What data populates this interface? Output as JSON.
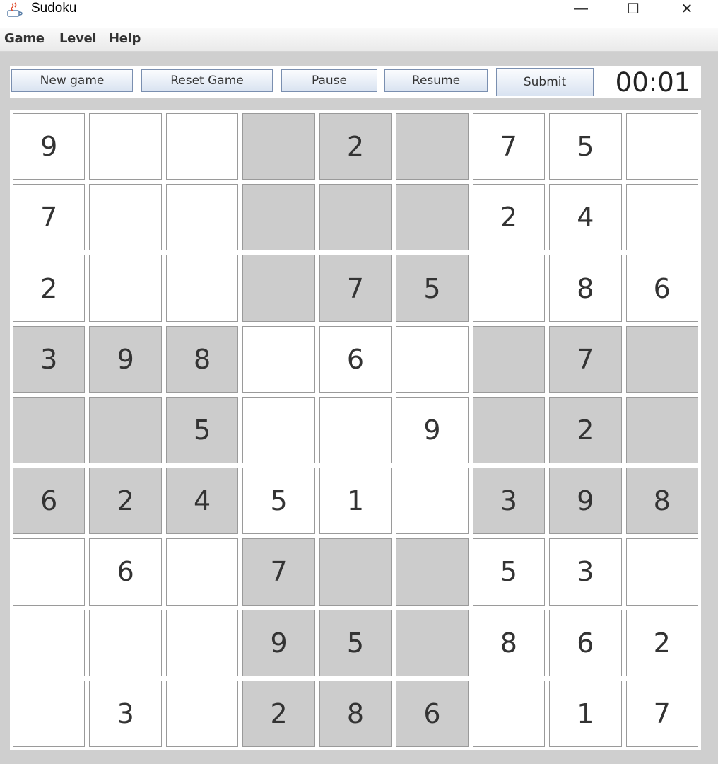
{
  "window": {
    "title": "Sudoku",
    "minimize_glyph": "—",
    "maximize_glyph": "☐",
    "close_glyph": "✕"
  },
  "menu": [
    "Game",
    "Level",
    "Help"
  ],
  "toolbar": {
    "new_game_label": "New game",
    "reset_label": "Reset Game",
    "pause_label": "Pause",
    "resume_label": "Resume",
    "submit_label": "Submit",
    "timer": "00:01"
  },
  "colors": {
    "shaded_box": "#cccccc",
    "light_box": "#ffffff",
    "background": "#cfcfcf"
  },
  "board": {
    "rows": [
      [
        "9",
        "",
        "",
        "",
        "2",
        "",
        "7",
        "5",
        ""
      ],
      [
        "7",
        "",
        "",
        "",
        "",
        "",
        "2",
        "4",
        ""
      ],
      [
        "2",
        "",
        "",
        "",
        "7",
        "5",
        "",
        "8",
        "6"
      ],
      [
        "3",
        "9",
        "8",
        "",
        "6",
        "",
        "",
        "7",
        ""
      ],
      [
        "",
        "",
        "5",
        "",
        "",
        "9",
        "",
        "2",
        ""
      ],
      [
        "6",
        "2",
        "4",
        "5",
        "1",
        "",
        "3",
        "9",
        "8"
      ],
      [
        "",
        "6",
        "",
        "7",
        "",
        "",
        "5",
        "3",
        ""
      ],
      [
        "",
        "",
        "",
        "9",
        "5",
        "",
        "8",
        "6",
        "2"
      ],
      [
        "",
        "3",
        "",
        "2",
        "8",
        "6",
        "",
        "1",
        "7"
      ]
    ],
    "shaded_boxes": [
      [
        0,
        1
      ],
      [
        1,
        0
      ],
      [
        1,
        2
      ],
      [
        2,
        1
      ]
    ]
  }
}
